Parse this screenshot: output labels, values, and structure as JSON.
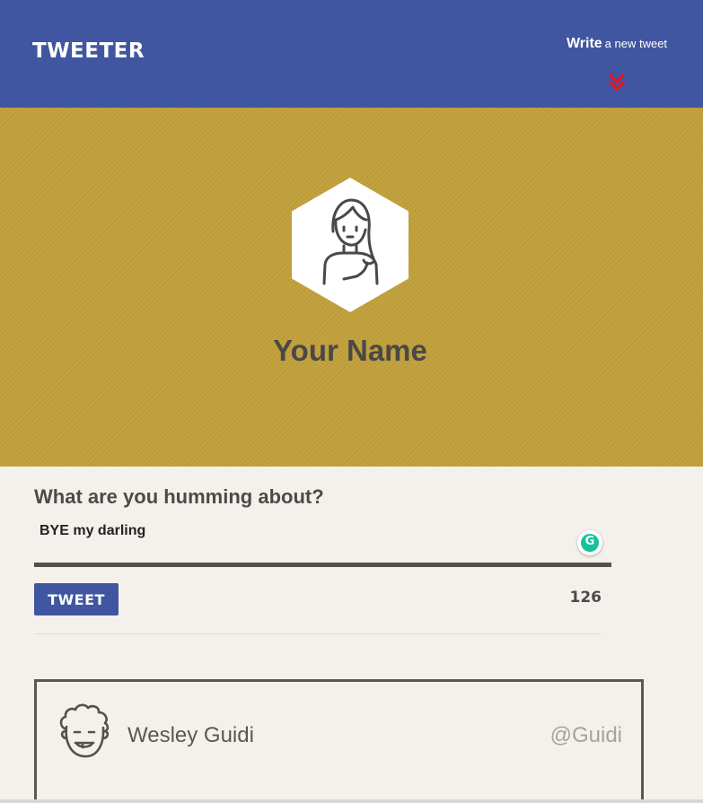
{
  "header": {
    "logo": "Tweeter",
    "write_strong": "Write",
    "write_light": "a new tweet",
    "background": "#4056a1",
    "toggle_icon": "chevron-double-down-icon",
    "toggle_icon_color": "#e8141c"
  },
  "profile": {
    "name": "Your Name",
    "avatar_icon": "avatar-woman-icon",
    "banner_color": "#c1a03b"
  },
  "compose": {
    "label": "What are you humming about?",
    "text": "BYE my darling",
    "button_label": "Tweet",
    "counter": "126",
    "grammarly_icon": "grammarly-icon"
  },
  "tweets": [
    {
      "author": "Wesley Guidi",
      "handle": "@Guidi",
      "avatar_icon": "avatar-curly-hair-icon"
    }
  ]
}
